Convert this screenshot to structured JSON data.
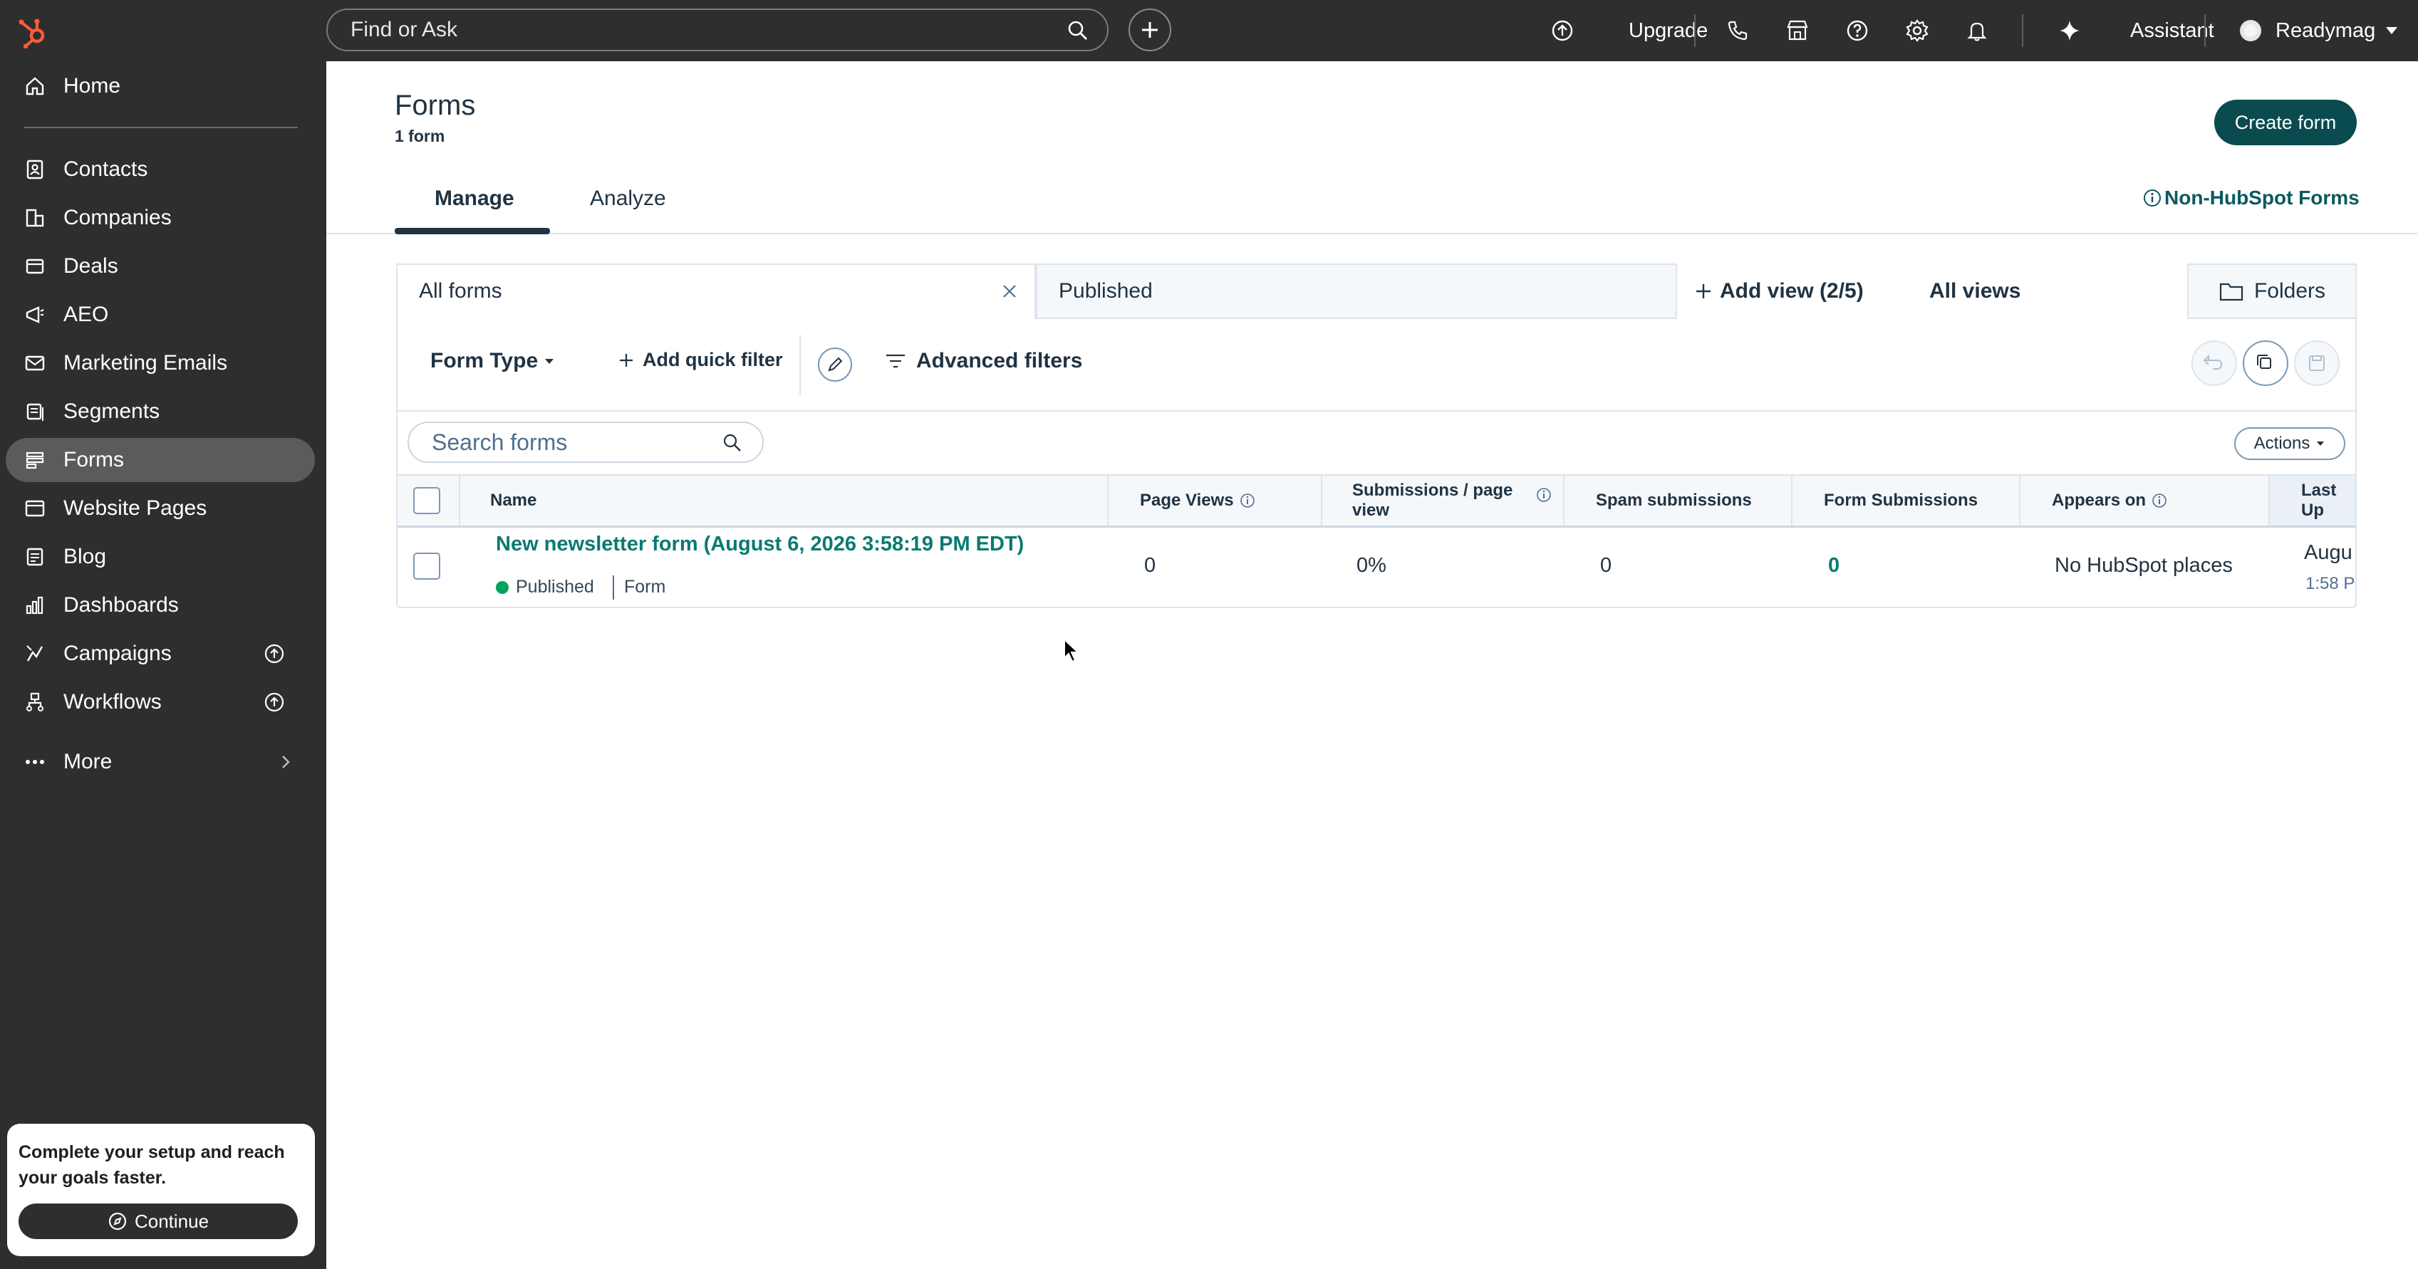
{
  "sidebar": {
    "items": [
      {
        "label": "Home",
        "icon": "home-icon"
      },
      {
        "label": "Contacts",
        "icon": "contacts-icon"
      },
      {
        "label": "Companies",
        "icon": "companies-icon"
      },
      {
        "label": "Deals",
        "icon": "deals-icon"
      },
      {
        "label": "AEO",
        "icon": "aeo-icon"
      },
      {
        "label": "Marketing Emails",
        "icon": "email-icon"
      },
      {
        "label": "Segments",
        "icon": "segments-icon"
      },
      {
        "label": "Forms",
        "icon": "forms-icon"
      },
      {
        "label": "Website Pages",
        "icon": "website-pages-icon"
      },
      {
        "label": "Blog",
        "icon": "blog-icon"
      },
      {
        "label": "Dashboards",
        "icon": "dashboards-icon"
      },
      {
        "label": "Campaigns",
        "icon": "campaigns-icon"
      },
      {
        "label": "Workflows",
        "icon": "workflows-icon"
      },
      {
        "label": "More",
        "icon": "more-icon"
      }
    ],
    "active": "Forms",
    "setup_text": "Complete your setup and reach your goals faster.",
    "continue_label": "Continue"
  },
  "topbar": {
    "search_placeholder": "Find or Ask",
    "upgrade_label": "Upgrade",
    "assistant_label": "Assistant",
    "account_label": "Readymag"
  },
  "header": {
    "title": "Forms",
    "subtitle": "1 form",
    "create_label": "Create form",
    "tabs": [
      "Manage",
      "Analyze"
    ],
    "active_tab": "Manage",
    "non_hubspot_label": "Non-HubSpot Forms"
  },
  "views": {
    "tabs": [
      "All forms",
      "Published"
    ],
    "add_view_label": "Add view (2/5)",
    "all_views_label": "All views",
    "folders_label": "Folders"
  },
  "filters": {
    "form_type_label": "Form Type",
    "quick_filter_label": "Add quick filter",
    "advanced_label": "Advanced filters"
  },
  "table": {
    "search_placeholder": "Search forms",
    "actions_label": "Actions",
    "columns": [
      "Name",
      "Page Views",
      "Submissions / page view",
      "Spam submissions",
      "Form Submissions",
      "Appears on",
      "Last Up"
    ],
    "rows": [
      {
        "name": "New newsletter form (August 6, 2026 3:58:19 PM EDT)",
        "status": "Published",
        "type": "Form",
        "page_views": "0",
        "submissions_per_view": "0%",
        "spam": "0",
        "form_submissions": "0",
        "appears_on": "No HubSpot places",
        "last_updated": "Augu",
        "last_updated_time": "1:58 P"
      }
    ]
  },
  "colors": {
    "sidebar_bg": "#2e2e2e",
    "active_item_bg": "#5b5b5b",
    "primary_button": "#0a4b4f",
    "link": "#0a7a72",
    "published_dot": "#00a35c",
    "brand_orange": "#ff5c35"
  }
}
